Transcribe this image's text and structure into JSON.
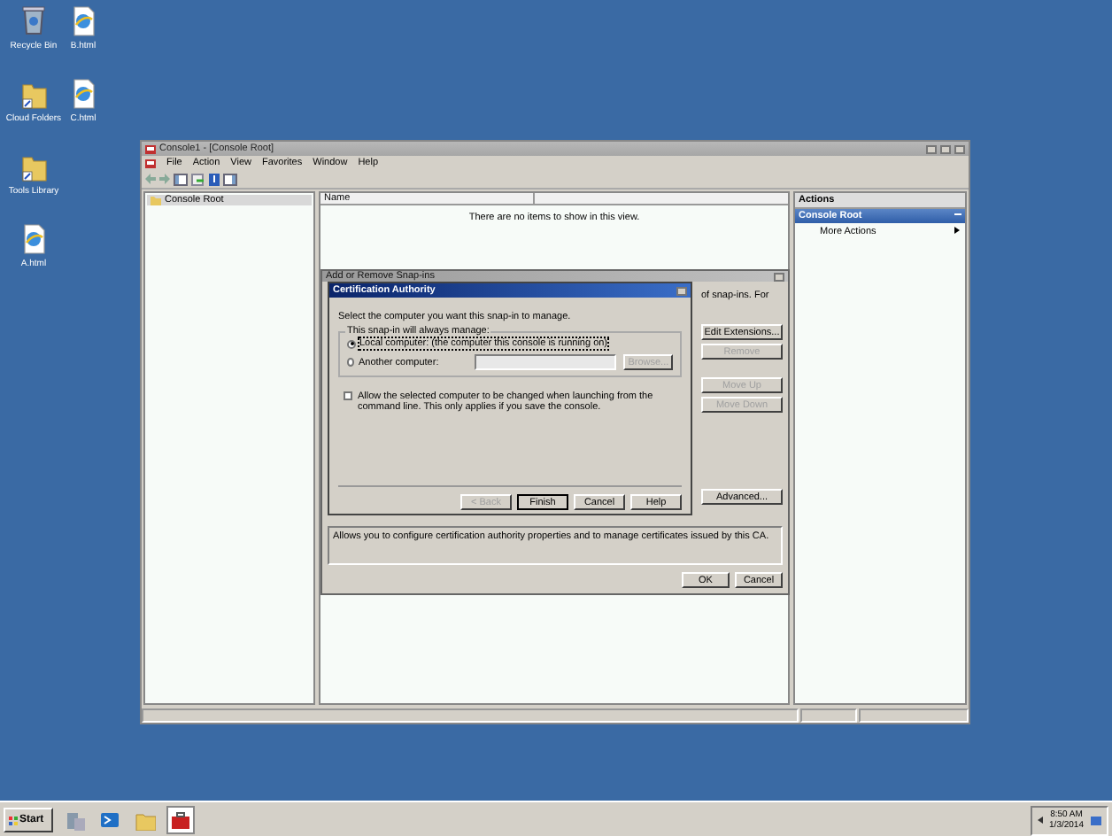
{
  "desktop_icons": [
    {
      "label": "Recycle Bin",
      "kind": "recycle"
    },
    {
      "label": "B.html",
      "kind": "html"
    },
    {
      "label": "Cloud Folders",
      "kind": "folder"
    },
    {
      "label": "C.html",
      "kind": "html"
    },
    {
      "label": "Tools Library",
      "kind": "folder"
    },
    {
      "label": "A.html",
      "kind": "html"
    }
  ],
  "console": {
    "title": "Console1 - [Console Root]",
    "menu": [
      "File",
      "Action",
      "View",
      "Favorites",
      "Window",
      "Help"
    ],
    "tree": [
      {
        "label": "Console Root",
        "selected": true
      }
    ],
    "list": {
      "columns": [
        "Name"
      ],
      "empty_message": "There are no items to show in this view."
    },
    "actions": {
      "title": "Actions",
      "section": "Console Root",
      "items": [
        {
          "label": "More Actions"
        }
      ]
    }
  },
  "snapin_dialog": {
    "title": "Add or Remove Snap-ins",
    "text_fragment": "of snap-ins. For",
    "buttons": [
      {
        "label": "Edit Extensions...",
        "disabled": false
      },
      {
        "label": "Remove",
        "disabled": true
      },
      {
        "label": "Move Up",
        "disabled": true
      },
      {
        "label": "Move Down",
        "disabled": true
      },
      {
        "label": "Advanced...",
        "disabled": false
      }
    ],
    "description": "Allows you to configure certification authority properties and to manage certificates issued by this CA.",
    "footer_buttons": [
      {
        "label": "OK",
        "disabled": false
      },
      {
        "label": "Cancel",
        "disabled": false
      }
    ]
  },
  "ca_dialog": {
    "title": "Certification Authority",
    "prompt": "Select the computer you want this snap-in to manage.",
    "group_label": "This snap-in will always manage:",
    "options": [
      {
        "label": "Local computer:  (the computer this console is running on)",
        "selected": true
      },
      {
        "label": "Another computer:",
        "selected": false
      }
    ],
    "browse_button": {
      "label": "Browse...",
      "disabled": true
    },
    "checkbox": {
      "label": "Allow the selected computer to be changed when launching from the command line. This only applies if you save the console.",
      "checked": false
    },
    "buttons": [
      {
        "label": "< Back",
        "disabled": true
      },
      {
        "label": "Finish",
        "disabled": false
      },
      {
        "label": "Cancel",
        "disabled": false
      },
      {
        "label": "Help",
        "disabled": false
      }
    ]
  },
  "taskbar": {
    "start": "Start",
    "apps": [
      {
        "kind": "server",
        "active": false
      },
      {
        "kind": "powershell",
        "active": false
      },
      {
        "kind": "explorer",
        "active": false
      },
      {
        "kind": "toolbox",
        "active": true
      }
    ],
    "time": "8:50 AM",
    "date": "1/3/2014"
  }
}
